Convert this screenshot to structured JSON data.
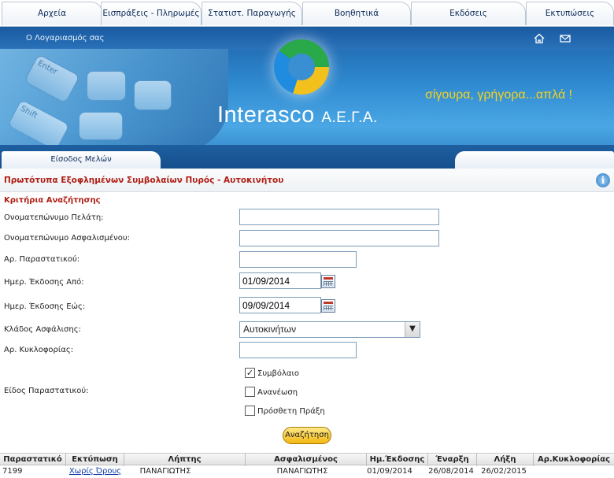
{
  "nav": {
    "items": [
      "Αρχεία",
      "Εισπράξεις - Πληρωμές",
      "Στατιστ. Παραγωγής",
      "Βοηθητικά",
      "Εκδόσεις",
      "Εκτυπώσεις"
    ]
  },
  "banner": {
    "account_link": "Ο Λογαριασμός σας",
    "brand_name": "Interasco",
    "brand_suffix": "Α.Ε.Γ.Α.",
    "slogan": "σίγουρα, γρήγορα...απλά !",
    "login_tab": "Είσοδος Μελών",
    "keys": [
      "Enter",
      "Shift"
    ],
    "icons": [
      "home-icon",
      "mail-icon"
    ]
  },
  "page": {
    "title": "Πρωτότυπα Εξοφλημένων Συμβολαίων Πυρός - Αυτοκινήτου"
  },
  "form": {
    "section_label": "Κριτήρια Αναζήτησης",
    "client_name_label": "Ονοματεπώνυμο Πελάτη:",
    "client_name_value": "",
    "insured_name_label": "Ονοματεπώνυμο Ασφαλισμένου:",
    "insured_name_value": "",
    "doc_number_label": "Αρ. Παραστατικού:",
    "doc_number_value": "",
    "date_from_label": "Ημερ. Έκδοσης Από:",
    "date_from_value": "01/09/2014",
    "date_to_label": "Ημερ. Έκδοσης Εώς:",
    "date_to_value": "09/09/2014",
    "branch_label": "Κλάδος Ασφάλισης:",
    "branch_value": "Αυτοκινήτων",
    "plate_label": "Αρ. Κυκλοφορίας:",
    "plate_value": "",
    "doc_type_label": "Είδος Παραστατικού:",
    "doc_types": [
      {
        "label": "Συμβόλαιο",
        "checked": true
      },
      {
        "label": "Ανανέωση",
        "checked": false
      },
      {
        "label": "Πρόσθετη Πράξη",
        "checked": false
      }
    ],
    "search_button": "Αναζήτηση"
  },
  "results": {
    "columns": [
      "Παραστατικό",
      "Εκτύπωση",
      "Λήπτης",
      "Ασφαλισμένος",
      "Ημ.Έκδοσης",
      "Έναρξη",
      "Λήξη",
      "Αρ.Κυκλοφορίας"
    ],
    "rows": [
      {
        "doc": "7199",
        "print": "Χωρίς Όρους",
        "recipient": "ΠΑΝΑΓΙΩΤΗΣ",
        "insured": "ΠΑΝΑΓΙΩΤΗΣ",
        "issue_date": "01/09/2014",
        "start": "26/08/2014",
        "end": "26/02/2015",
        "plate": ""
      }
    ]
  },
  "colors": {
    "title_red": "#b01e14",
    "nav_text": "#0c2a57",
    "banner_blue": "#2f8ad0",
    "slogan_yellow": "#f7d21c",
    "link_blue": "#0b39a8",
    "button_yellow": "#f3b711"
  }
}
